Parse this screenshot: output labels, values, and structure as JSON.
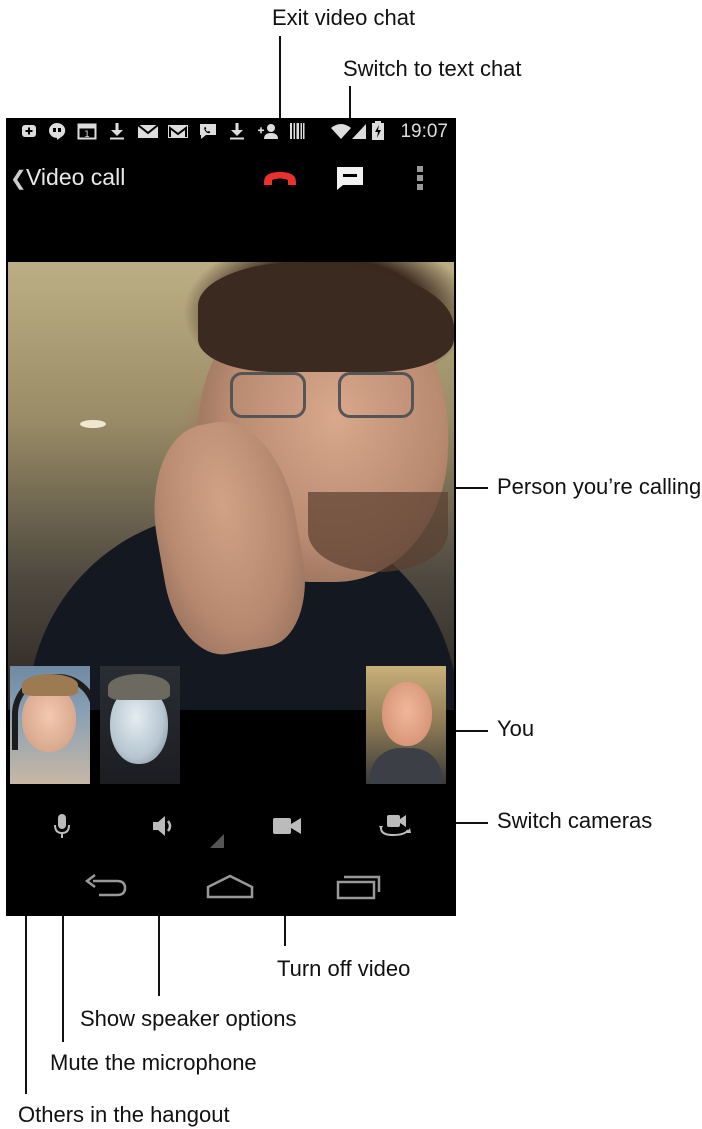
{
  "callouts": {
    "exit_video_chat": "Exit video chat",
    "switch_to_text_chat": "Switch to text chat",
    "person_calling": "Person you’re calling",
    "you": "You",
    "switch_cameras": "Switch cameras",
    "turn_off_video": "Turn off video",
    "show_speaker_options": "Show speaker options",
    "mute_microphone": "Mute the microphone",
    "others_in_hangout": "Others in the hangout"
  },
  "status_bar": {
    "time": "19:07",
    "calendar_day": "1",
    "icons": [
      "add-icon",
      "hangouts-icon",
      "calendar-icon",
      "download-icon",
      "mail-icon",
      "gmail-icon",
      "phone-msg-icon",
      "download-icon",
      "add-contact-icon",
      "barcode-icon",
      "wifi-icon",
      "signal-icon",
      "battery-charging-icon"
    ]
  },
  "action_bar": {
    "title": "Video call",
    "end_call_color": "#e8322e"
  },
  "controls": {
    "icons": [
      "microphone-icon",
      "speaker-icon",
      "video-camera-icon",
      "switch-camera-icon"
    ]
  },
  "navigation": {
    "icons": [
      "back-icon",
      "home-icon",
      "recent-apps-icon"
    ]
  }
}
